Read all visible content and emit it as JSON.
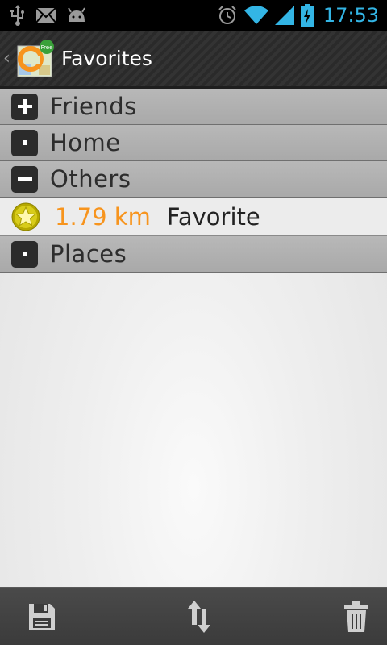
{
  "status_bar": {
    "time": "17:53",
    "left_icons": [
      "usb-icon",
      "gmail-icon",
      "android-icon"
    ],
    "right_icons": [
      "alarm-icon",
      "wifi-icon",
      "signal-icon",
      "battery-charging-icon"
    ],
    "accent_color": "#33b5e5"
  },
  "action_bar": {
    "title": "Favorites",
    "logo_badge": "Free"
  },
  "list": {
    "groups": [
      {
        "label": "Friends",
        "indicator": "expand-plus"
      },
      {
        "label": "Home",
        "indicator": "empty-dot"
      },
      {
        "label": "Others",
        "indicator": "collapse-minus"
      },
      {
        "label": "Places",
        "indicator": "empty-dot"
      }
    ],
    "children": {
      "Others": [
        {
          "distance": "1.79 km",
          "name": "Favorite",
          "icon": "star-icon"
        }
      ]
    },
    "distance_color": "#f7941d"
  },
  "bottom_bar": {
    "buttons": [
      "save-icon",
      "sort-icon",
      "trash-icon"
    ]
  }
}
